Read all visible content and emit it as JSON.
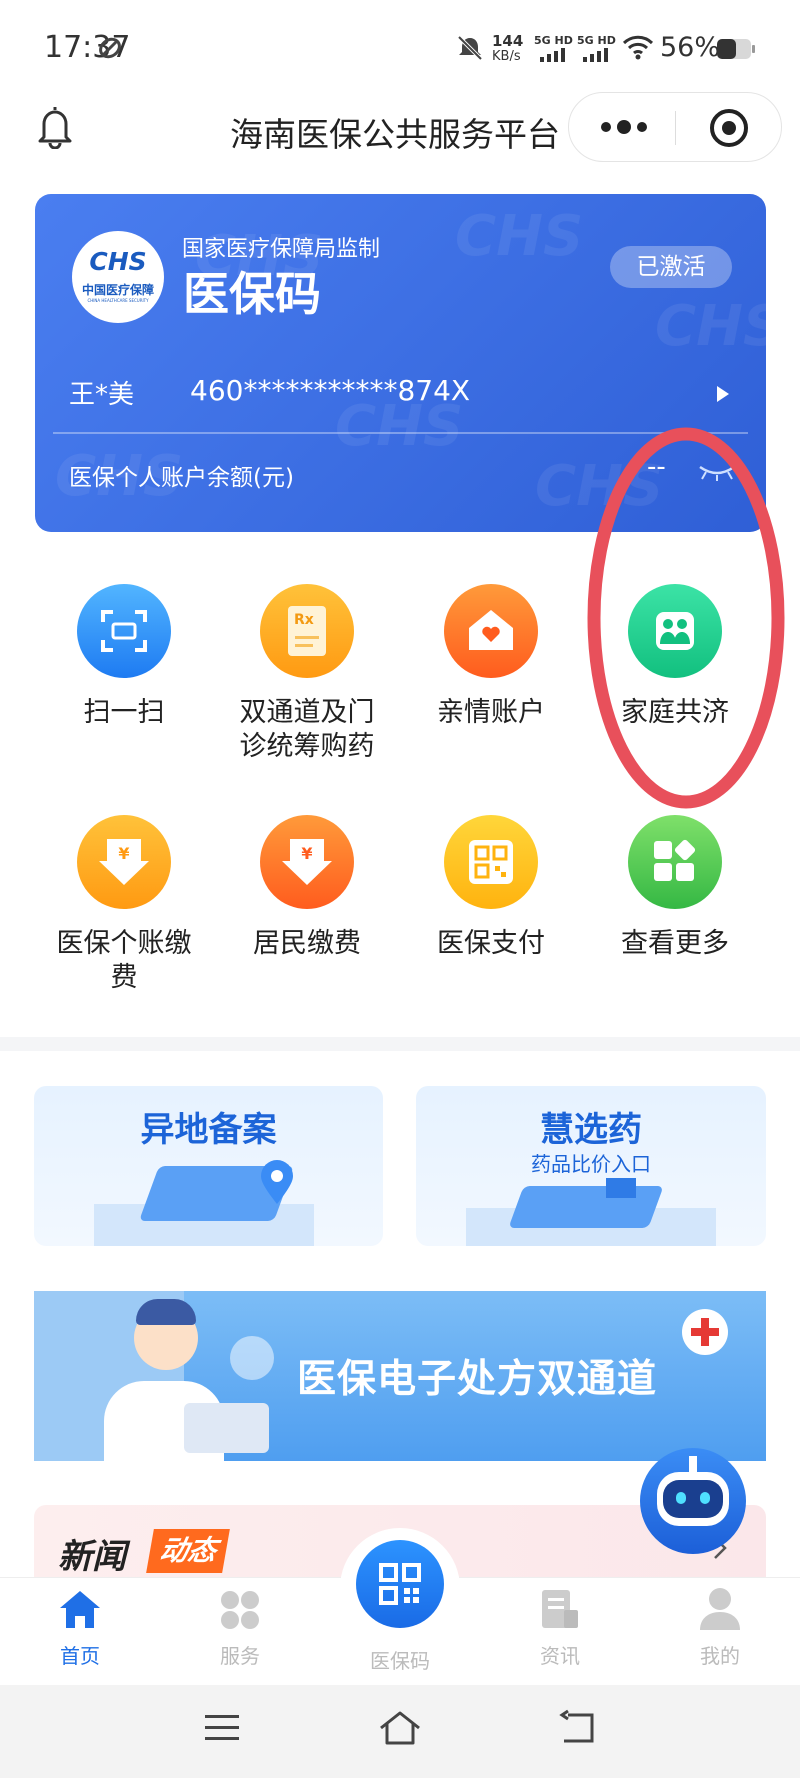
{
  "status": {
    "time": "17:37",
    "net_speed_top": "144",
    "net_speed_bottom": "KB/s",
    "signal1": "5G HD",
    "signal2": "5G HD",
    "battery": "56%"
  },
  "nav": {
    "title": "海南医保公共服务平台"
  },
  "card": {
    "supervisor": "国家医疗保障局监制",
    "title": "医保码",
    "status_badge": "已激活",
    "name": "王*美",
    "id_number": "460***********874X",
    "balance_label": "医保个人账户余额(元)",
    "balance_value": "--",
    "logo_letters": "CHS",
    "logo_cn": "中国医疗保障",
    "logo_en": "CHINA HEALTHCARE SECURITY",
    "watermark": "CHS"
  },
  "grid": [
    {
      "label": "扫一扫"
    },
    {
      "label_line1": "双通道及门",
      "label_line2": "诊统筹购药",
      "icon_text": "Rx"
    },
    {
      "label": "亲情账户"
    },
    {
      "label": "家庭共济"
    },
    {
      "label_line1": "医保个账缴",
      "label_line2": "费",
      "icon_text": "¥"
    },
    {
      "label": "居民缴费",
      "icon_text": "¥"
    },
    {
      "label": "医保支付"
    },
    {
      "label": "查看更多"
    }
  ],
  "promos": {
    "left_title": "异地备案",
    "right_title": "慧选药",
    "right_subtitle": "药品比价入口"
  },
  "banner": {
    "text": "医保电子处方双通道"
  },
  "news": {
    "title_a": "新闻",
    "title_b": "动态"
  },
  "tabbar": [
    {
      "label": "首页"
    },
    {
      "label": "服务"
    },
    {
      "label": "医保码"
    },
    {
      "label": "资讯"
    },
    {
      "label": "我的"
    }
  ],
  "colors": {
    "accent": "#1f6fe6",
    "card_blue": "#3a6de0",
    "annotation_red": "#e8505b"
  }
}
